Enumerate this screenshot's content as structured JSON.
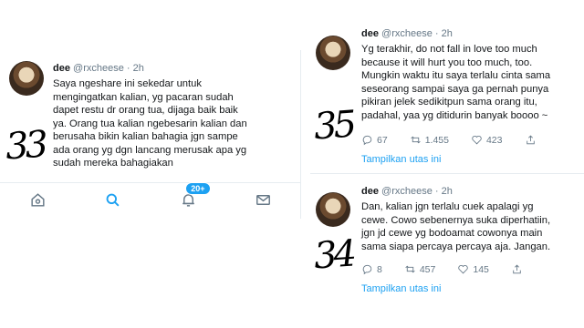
{
  "tweets": [
    {
      "name": "dee",
      "handle": "@rxcheese · 2h",
      "text": "Saya ngeshare ini sekedar untuk\nmengingatkan kalian, yg pacaran sudah\ndapet restu dr orang tua, dijaga baik baik\nya. Orang tua kalian ngebesarin kalian dan\nberusaha bikin kalian bahagia jgn sampe\nada orang yg dgn lancang merusak apa yg\nsudah mereka bahagiakan",
      "handwritten_number": "33"
    },
    {
      "name": "dee",
      "handle": "@rxcheese · 2h",
      "text": "Yg terakhir, do not fall in love too much\nbecause it will hurt you too much, too.\nMungkin waktu itu saya terlalu cinta sama\nseseorang sampai saya ga pernah punya\npikiran jelek sedikitpun sama orang itu,\npadahal, yaa yg ditidurin banyak boooo ~",
      "handwritten_number": "35",
      "replies": "67",
      "retweets": "1.455",
      "likes": "423",
      "show_thread": "Tampilkan utas ini"
    },
    {
      "name": "dee",
      "handle": "@rxcheese · 2h",
      "text": "Dan, kalian jgn terlalu cuek apalagi yg\ncewe. Cowo sebenernya suka diperhatiin,\njgn jd cewe yg bodoamat cowonya main\nsama siapa percaya percaya aja. Jangan.",
      "handwritten_number": "34",
      "replies": "8",
      "retweets": "457",
      "likes": "145",
      "show_thread": "Tampilkan utas ini"
    }
  ],
  "tabbar": {
    "notification_badge": "20+"
  },
  "colors": {
    "accent": "#1da1f2",
    "muted": "#657786"
  },
  "icons": [
    "home-icon",
    "search-icon",
    "bell-icon",
    "mail-icon",
    "reply-icon",
    "retweet-icon",
    "heart-icon",
    "share-icon"
  ]
}
